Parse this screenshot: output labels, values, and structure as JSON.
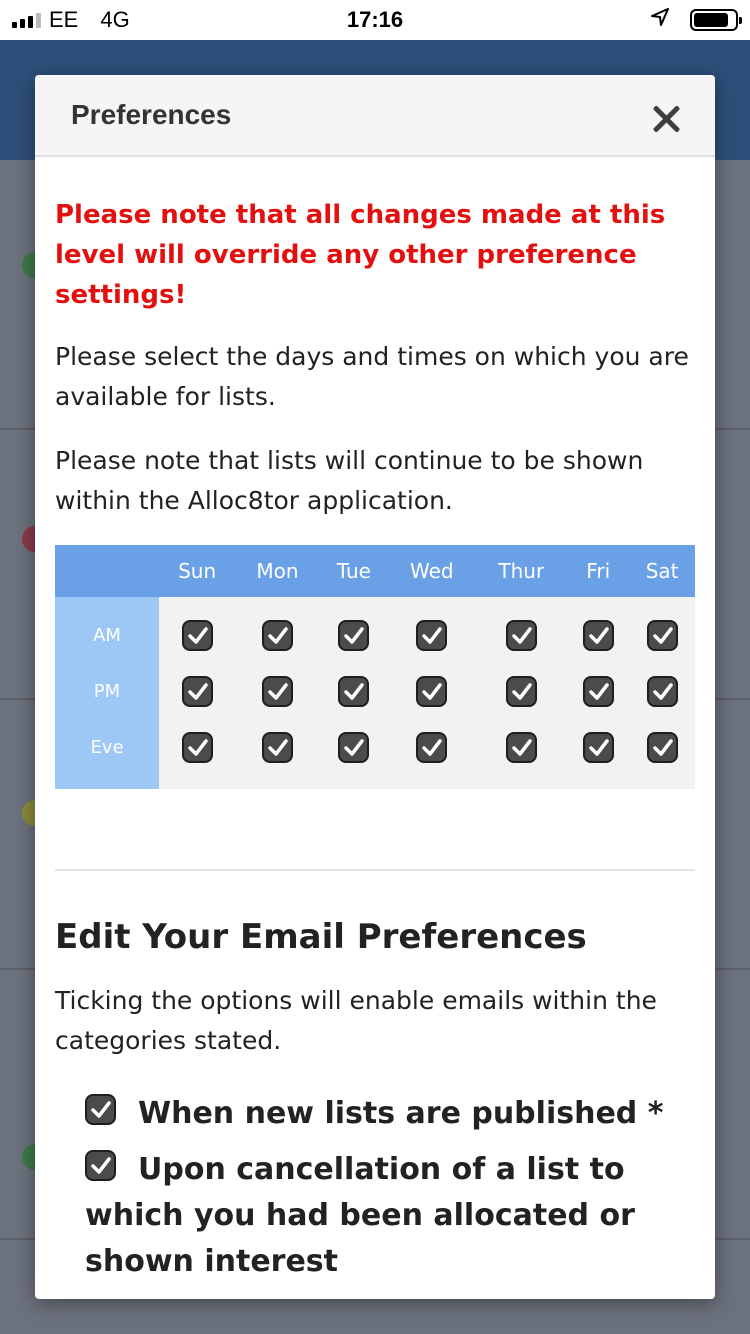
{
  "status_bar": {
    "carrier": "EE",
    "network": "4G",
    "time": "17:16"
  },
  "modal": {
    "title": "Preferences",
    "warning": "Please note that all changes made at this level will override any other preference settings!",
    "instruction": "Please select the days and times on which you are available for lists.",
    "note": "Please note that lists will continue to be shown within the Alloc8tor application."
  },
  "availability": {
    "days": [
      "Sun",
      "Mon",
      "Tue",
      "Wed",
      "Thur",
      "Fri",
      "Sat"
    ],
    "periods": [
      "AM",
      "PM",
      "Eve"
    ],
    "checked": [
      [
        true,
        true,
        true,
        true,
        true,
        true,
        true
      ],
      [
        true,
        true,
        true,
        true,
        true,
        true,
        true
      ],
      [
        true,
        true,
        true,
        true,
        true,
        true,
        true
      ]
    ]
  },
  "email_prefs": {
    "title": "Edit Your Email Preferences",
    "description": "Ticking the options will enable emails within the categories stated.",
    "options": [
      {
        "label": "When new lists are published *",
        "checked": true
      },
      {
        "label": "Upon cancellation of a list to which you had been allocated or shown interest",
        "checked": true
      }
    ]
  },
  "colors": {
    "warning": "#e31010",
    "table_header": "#6aa0e6",
    "row_label": "#9dc8f6"
  }
}
